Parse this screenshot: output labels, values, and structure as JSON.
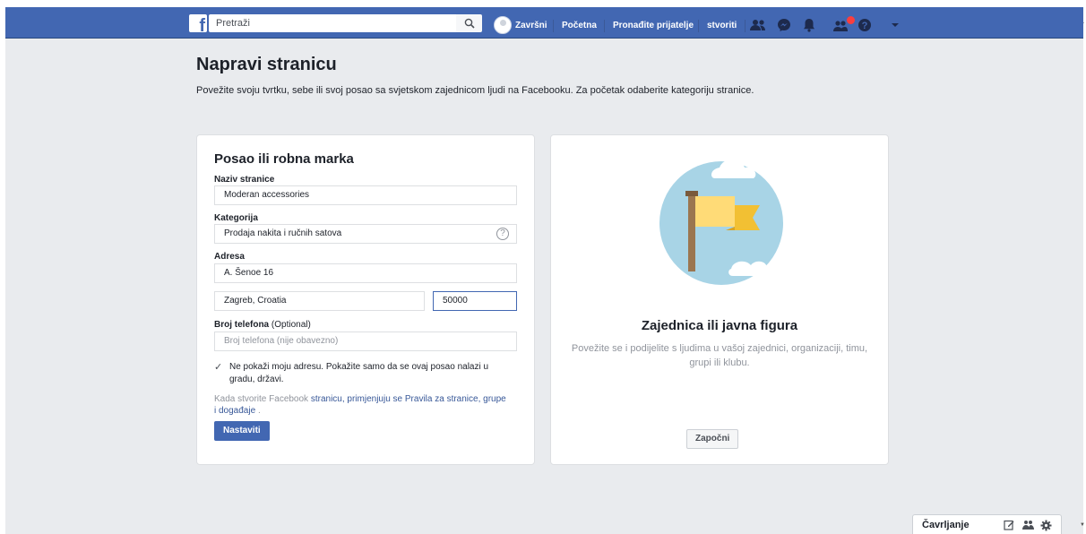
{
  "topbar": {
    "logo": "f",
    "search_placeholder": "Pretraži",
    "profile_name": "Završni",
    "nav": [
      "Početna",
      "Pronađite prijatelje",
      "stvoriti"
    ],
    "icons": [
      "friend-requests-icon",
      "messenger-icon",
      "notifications-icon",
      "groups-icon",
      "help-icon",
      "caret-down-icon"
    ],
    "brand_color": "#4267b2"
  },
  "header": {
    "title": "Napravi stranicu",
    "subtitle": "Povežite svoju tvrtku, sebe ili svoj posao sa svjetskom zajednicom ljudi na Facebooku. Za početak odaberite kategoriju stranice."
  },
  "form": {
    "title": "Posao ili robna marka",
    "page_name_label": "Naziv stranice",
    "page_name_value": "Moderan accessories",
    "category_label": "Kategorija",
    "category_value": "Prodaja nakita i ručnih satova",
    "address_label": "Adresa",
    "address_value": "A. Šenoe 16",
    "city_value": "Zagreb, Croatia",
    "zip_value": "50000",
    "phone_label": "Broj telefona",
    "phone_optional": "(Optional)",
    "phone_placeholder": "Broj telefona (nije obavezno)",
    "hide_address_checked": true,
    "hide_address_text": "Ne pokaži moju adresu. Pokažite samo da se ovaj posao nalazi u gradu, državi.",
    "policy_prefix": "Kada stvorite Facebook",
    "policy_link": "stranicu, primjenjuju se Pravila za stranice, grupe i događaje",
    "policy_suffix": ".",
    "continue_label": "Nastaviti"
  },
  "community": {
    "title": "Zajednica ili javna figura",
    "description": "Povežite se i podijelite s ljudima u vašoj zajednici, organizaciji, timu, grupi ili klubu.",
    "start_label": "Započni"
  },
  "chat": {
    "label": "Čavrljanje"
  }
}
